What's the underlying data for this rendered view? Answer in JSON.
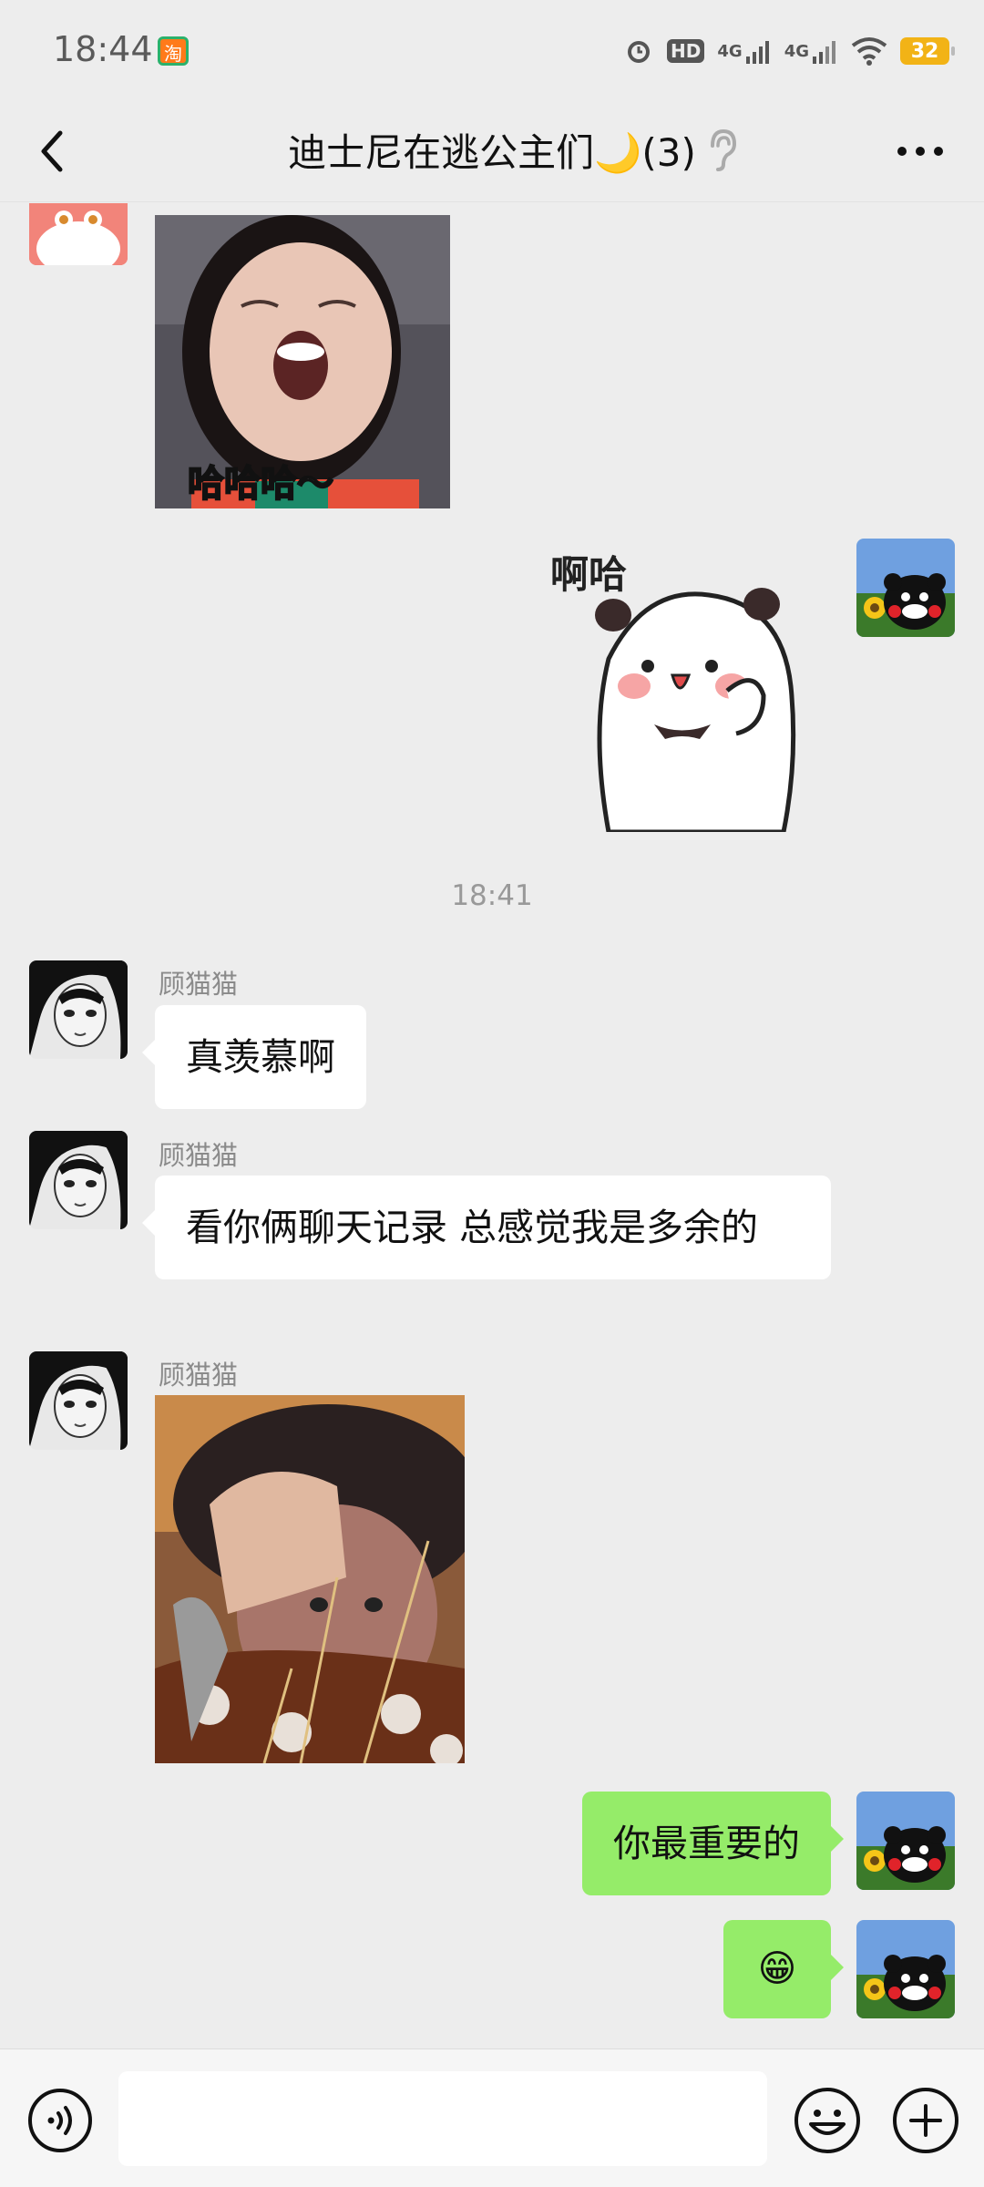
{
  "status_bar": {
    "time": "18:44",
    "network_1": "4G",
    "network_2": "4G",
    "hd_label": "HD",
    "battery": "32"
  },
  "header": {
    "title": "迪士尼在逃公主们🌙(3)"
  },
  "messages": {
    "sticker_1_caption": "哈哈哈～",
    "sticker_2_caption": "啊哈",
    "timestamp": "18:41",
    "msg_1": {
      "sender": "顾猫猫",
      "text": "真羡慕啊"
    },
    "msg_2": {
      "sender": "顾猫猫",
      "text": "看你俩聊天记录 总感觉我是多余的"
    },
    "msg_3": {
      "sender": "顾猫猫"
    },
    "msg_4": {
      "text": "你最重要的"
    },
    "msg_5": {
      "text": "😁"
    }
  },
  "input_bar": {
    "placeholder": ""
  },
  "icons": {
    "back": "chevron-left-icon",
    "more": "more-dots-icon",
    "ear": "ear-icon",
    "voice": "voice-icon",
    "emoji": "emoji-icon",
    "plus": "plus-icon"
  },
  "colors": {
    "background": "#ededed",
    "outgoing_bubble": "#95ec69",
    "incoming_bubble": "#ffffff",
    "battery": "#f2b316"
  }
}
